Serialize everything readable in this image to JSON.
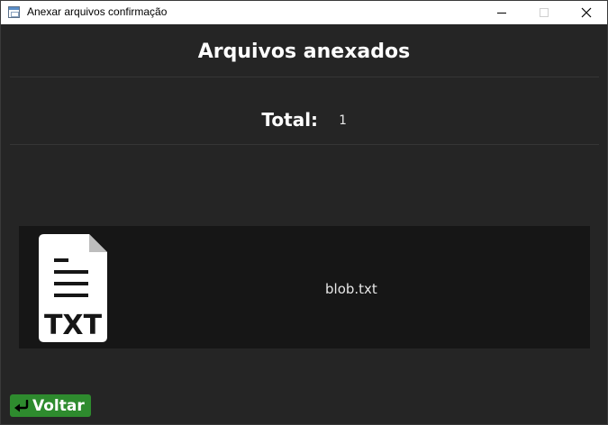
{
  "window": {
    "title": "Anexar arquivos confirmação",
    "icons": {
      "app": "window-app-icon",
      "minimize": "minimize-icon",
      "maximize": "maximize-icon",
      "close": "close-icon"
    }
  },
  "header": {
    "title": "Arquivos anexados"
  },
  "summary": {
    "total_label": "Total:",
    "total_value": "1"
  },
  "files": [
    {
      "name": "blob.txt",
      "type_label": "TXT",
      "icon": "txt-file-icon"
    }
  ],
  "footer": {
    "back_label": "Voltar",
    "back_icon": "return-arrow-icon"
  },
  "colors": {
    "background": "#252525",
    "card": "#161616",
    "button_green": "#2e8b2e",
    "text": "#ffffff"
  }
}
